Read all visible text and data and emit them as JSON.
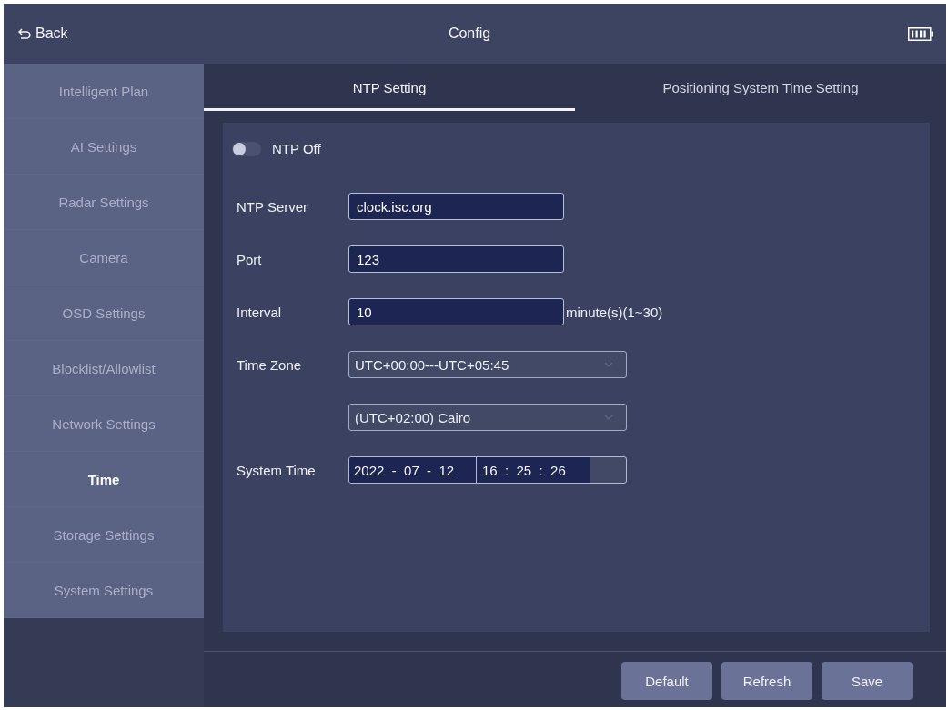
{
  "header": {
    "back": "Back",
    "title": "Config"
  },
  "sidebar": {
    "items": [
      {
        "label": "Intelligent Plan",
        "selected": false
      },
      {
        "label": "AI Settings",
        "selected": false
      },
      {
        "label": "Radar Settings",
        "selected": false
      },
      {
        "label": "Camera",
        "selected": false
      },
      {
        "label": "OSD Settings",
        "selected": false
      },
      {
        "label": "Blocklist/Allowlist",
        "selected": false
      },
      {
        "label": "Network Settings",
        "selected": false
      },
      {
        "label": "Time",
        "selected": true
      },
      {
        "label": "Storage Settings",
        "selected": false
      },
      {
        "label": "System Settings",
        "selected": false
      }
    ]
  },
  "tabs": [
    {
      "label": "NTP Setting",
      "selected": true
    },
    {
      "label": "Positioning System Time Setting",
      "selected": false
    }
  ],
  "ntp_toggle": {
    "label": "NTP Off",
    "on": false
  },
  "form": {
    "fields": [
      {
        "kind": "text",
        "label": "NTP Server",
        "value": "clock.isc.org"
      },
      {
        "kind": "text",
        "label": "Port",
        "value": "123"
      },
      {
        "kind": "text",
        "label": "Interval",
        "value": "10",
        "unit": "minute(s)(1~30)"
      },
      {
        "kind": "select",
        "label": "Time Zone",
        "value": "UTC+00:00---UTC+05:45"
      },
      {
        "kind": "select",
        "value": "(UTC+02:00) Cairo"
      },
      {
        "kind": "datetime",
        "label": "System Time",
        "date": "2022  -  07  -  12",
        "time": "16  :  25  :  26"
      }
    ]
  },
  "buttons": [
    "Default",
    "Refresh",
    "Save"
  ]
}
